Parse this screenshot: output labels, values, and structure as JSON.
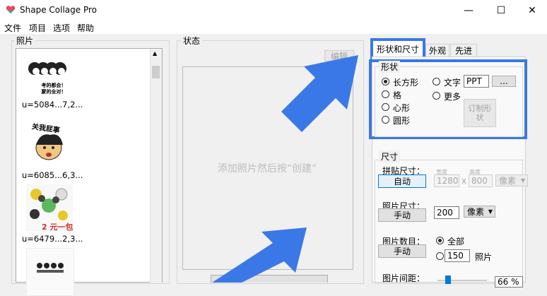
{
  "window": {
    "title": "Shape Collage Pro",
    "controls": {
      "minimize": "—",
      "maximize": "☐",
      "close": "✕"
    }
  },
  "menu": [
    "文件",
    "项目",
    "选项",
    "帮助"
  ],
  "photos": {
    "label": "照片",
    "items": [
      {
        "filename": "u=5084...7,2...",
        "caption": [
          "考的都会！",
          "蒙的全对！"
        ]
      },
      {
        "filename": "u=6085...6,3...",
        "caption": [
          "关我屁事"
        ]
      },
      {
        "filename": "u=6479...2,3...",
        "caption": [
          "2 元一包"
        ]
      },
      {
        "filename": "",
        "caption": []
      }
    ]
  },
  "status": {
    "label": "状态",
    "edit_button": "编辑",
    "canvas_hint": "添加照片然后按“创建”"
  },
  "tabs": [
    "形状和尺寸",
    "外观",
    "先进"
  ],
  "shape": {
    "label": "形状",
    "rect": "长方形",
    "grid": "格",
    "heart": "心形",
    "circle": "圆形",
    "text": "文字",
    "text_value": "PPT",
    "ellipsis": "...",
    "more": "更多",
    "custom": "订制形状"
  },
  "size": {
    "label": "尺寸",
    "collage_size": "拼贴尺寸：",
    "auto_button": "自动",
    "width_label": "宽度",
    "height_label": "高度",
    "width_value": "1280",
    "x": "x",
    "height_value": "800",
    "unit": "像素",
    "photo_size": "照片尺寸：",
    "manual1": "手动",
    "photo_size_value": "200",
    "photo_unit": "像素",
    "photo_count": "图片数目：",
    "manual2": "手动",
    "all": "全部",
    "count_value": "150",
    "count_unit": "照片",
    "spacing": "图片间距：",
    "spacing_value": "66 %"
  },
  "colors": {
    "accent_arrow": "#3b78e7",
    "highlight": "#3b78e7"
  }
}
